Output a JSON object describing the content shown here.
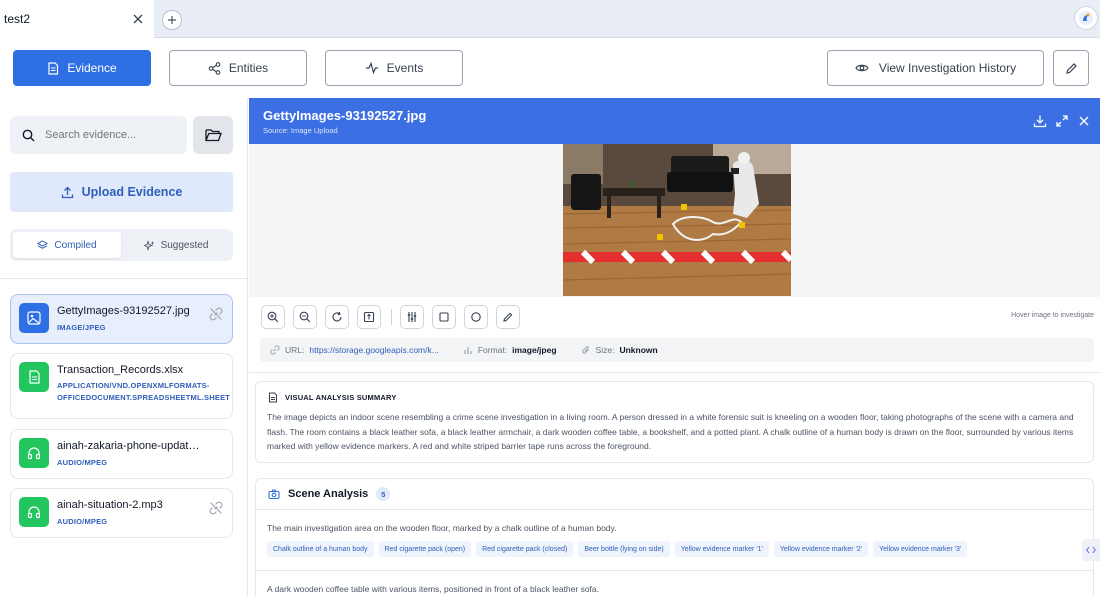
{
  "browser": {
    "tab_title": "test2"
  },
  "nav": {
    "evidence": "Evidence",
    "entities": "Entities",
    "events": "Events",
    "history": "View Investigation History"
  },
  "sidebar": {
    "search_placeholder": "Search evidence...",
    "upload_label": "Upload Evidence",
    "compiled_label": "Compiled",
    "suggested_label": "Suggested",
    "items": [
      {
        "name": "GettyImages-93192527.jpg",
        "type": "IMAGE/JPEG",
        "icon": "image-icon",
        "selected": true
      },
      {
        "name": "Transaction_Records.xlsx",
        "type": "APPLICATION/VND.OPENXMLFORMATS-OFFICEDOCUMENT.SPREADSHEETML.SHEET",
        "icon": "document-icon",
        "selected": false
      },
      {
        "name": "ainah-zakaria-phone-update....",
        "type": "AUDIO/MPEG",
        "icon": "headphones-icon",
        "selected": false
      },
      {
        "name": "ainah-situation-2.mp3",
        "type": "AUDIO/MPEG",
        "icon": "headphones-icon",
        "selected": false
      }
    ]
  },
  "viewer": {
    "title": "GettyImages-93192527.jpg",
    "source": "Source: Image Upload",
    "hover_hint": "Hover image to investigate",
    "meta": {
      "url_label": "URL:",
      "url_value": "https://storage.googleapis.com/k...",
      "format_label": "Format:",
      "format_value": "image/jpeg",
      "size_label": "Size:",
      "size_value": "Unknown"
    }
  },
  "summary": {
    "heading": "VISUAL ANALYSIS SUMMARY",
    "text": "The image depicts an indoor scene resembling a crime scene investigation in a living room. A person dressed in a white forensic suit is kneeling on a wooden floor, taking photographs of the scene with a camera and flash. The room contains a black leather sofa, a black leather armchair, a dark wooden coffee table, a bookshelf, and a potted plant. A chalk outline of a human body is drawn on the floor, surrounded by various items marked with yellow evidence markers. A red and white striped barrier tape runs across the foreground."
  },
  "scene": {
    "heading": "Scene Analysis",
    "count": "5",
    "desc1": "The main investigation area on the wooden floor, marked by a chalk outline of a human body.",
    "tags": [
      "Chalk outline of a human body",
      "Red cigarette pack (open)",
      "Red cigarette pack (closed)",
      "Beer bottle (lying on side)",
      "Yellow evidence marker '1'",
      "Yellow evidence marker '2'",
      "Yellow evidence marker '3'"
    ],
    "desc2": "A dark wooden coffee table with various items, positioned in front of a black leather sofa."
  },
  "colors": {
    "primary": "#2f6fe4",
    "header": "#3b6fe3",
    "green": "#22c55e"
  }
}
